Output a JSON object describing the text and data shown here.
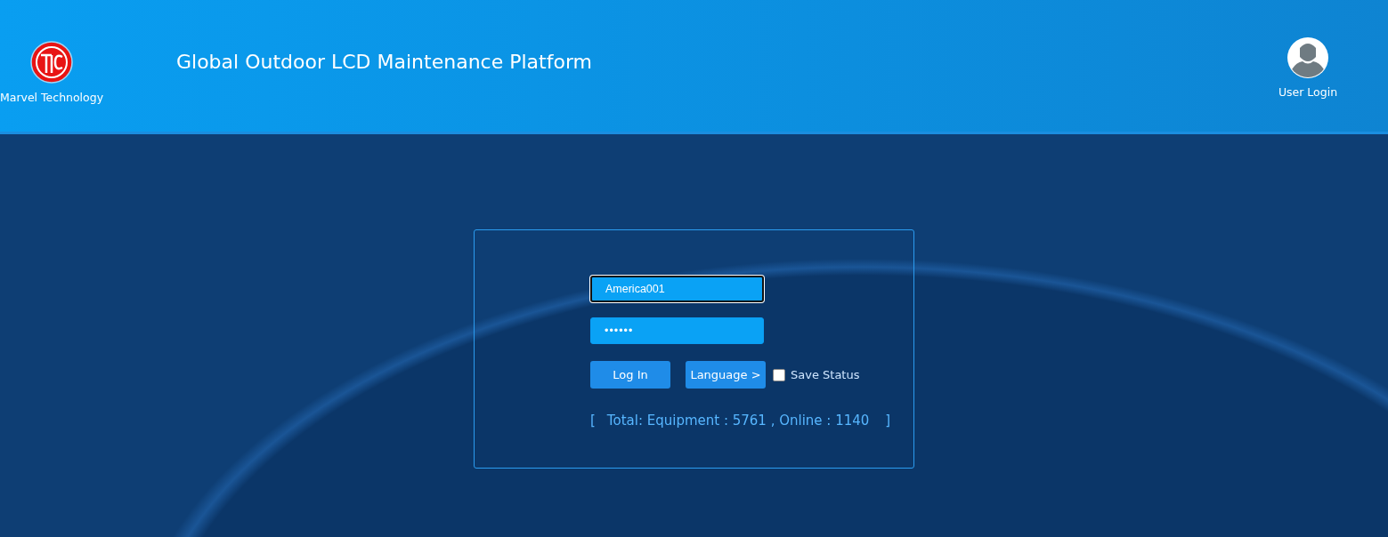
{
  "header": {
    "brand": "Marvel Technology",
    "title": "Global Outdoor LCD Maintenance Platform",
    "user_label": "User Login"
  },
  "login": {
    "fields": [
      {
        "kind": "text",
        "value": "America001",
        "focused": true
      },
      {
        "kind": "password",
        "value": "••••••",
        "focused": false
      }
    ],
    "buttons": [
      "Log In",
      "Language >"
    ],
    "save_status": {
      "label": "Save Status",
      "checked": false
    },
    "stats": {
      "open": "[",
      "text": "Total: Equipment : 5761 , Online : 1140",
      "close": "]"
    }
  }
}
